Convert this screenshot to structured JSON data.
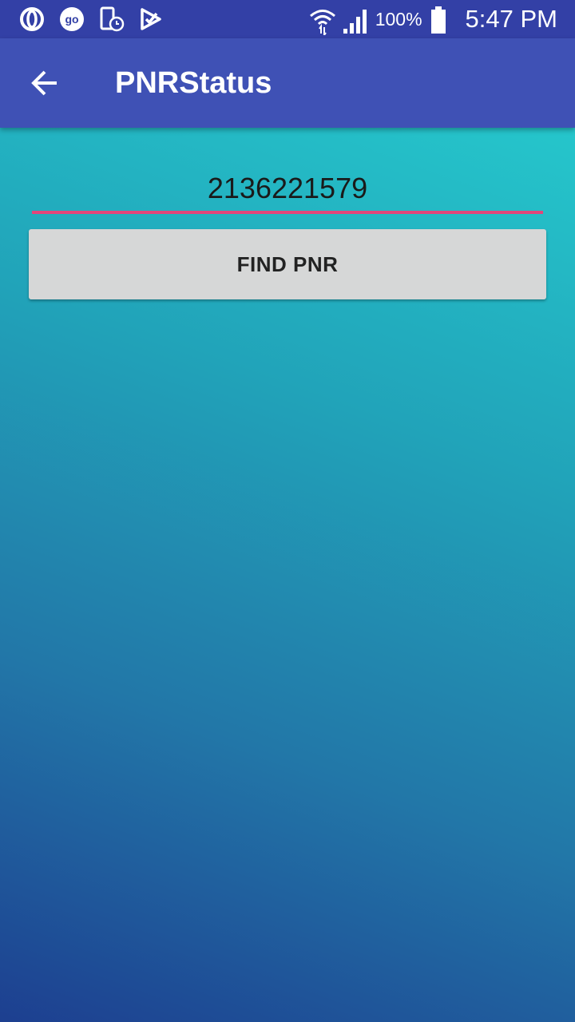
{
  "status_bar": {
    "left_icons": [
      "opera-icon",
      "go-icon",
      "phone-clock-icon",
      "checklist-icon"
    ],
    "right_icons": [
      "wifi-icon",
      "signal-icon",
      "battery-icon"
    ],
    "battery_text": "100%",
    "time": "5:47 PM"
  },
  "app_bar": {
    "back_icon": "arrow-back-icon",
    "title": "PNRStatus"
  },
  "form": {
    "pnr_value": "2136221579",
    "find_button_label": "FIND PNR"
  },
  "colors": {
    "status_bar": "#3340a6",
    "app_bar": "#3f51b5",
    "input_underline": "#e2467a",
    "button_bg": "#d6d7d7",
    "gradient_top": "#27d2d2",
    "gradient_bottom": "#1d3f90"
  }
}
